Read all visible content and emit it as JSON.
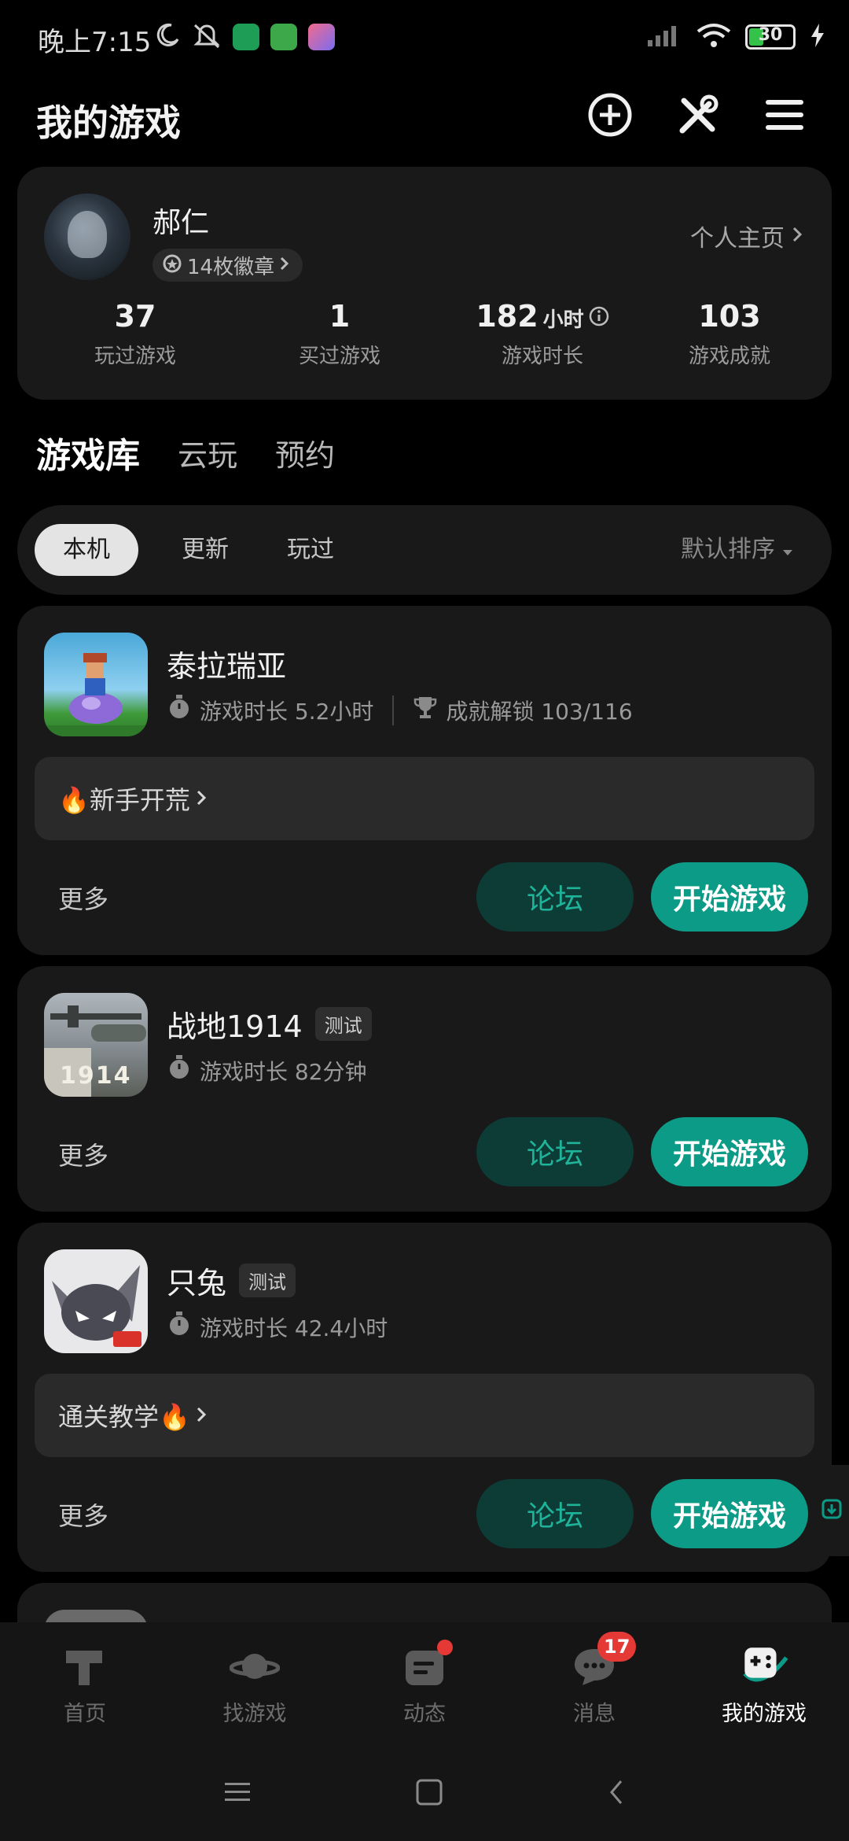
{
  "status_bar": {
    "time": "晚上7:15",
    "battery": "30"
  },
  "header": {
    "title": "我的游戏"
  },
  "profile": {
    "username": "郝仁",
    "badges": "14枚徽章",
    "profile_link": "个人主页",
    "stats": [
      {
        "value": "37",
        "unit": "",
        "label": "玩过游戏"
      },
      {
        "value": "1",
        "unit": "",
        "label": "买过游戏"
      },
      {
        "value": "182",
        "unit": "小时",
        "label": "游戏时长"
      },
      {
        "value": "103",
        "unit": "",
        "label": "游戏成就"
      }
    ]
  },
  "section_tabs": [
    "游戏库",
    "云玩",
    "预约"
  ],
  "filters": {
    "chips": [
      "本机",
      "更新",
      "玩过"
    ],
    "sort": "默认排序"
  },
  "games": [
    {
      "name": "泰拉瑞亚",
      "tag": "",
      "playtime": "游戏时长 5.2小时",
      "achievements": "成就解锁 103/116",
      "tip": "🔥新手开荒",
      "more": "更多",
      "forum": "论坛",
      "start": "开始游戏"
    },
    {
      "name": "战地1914",
      "tag": "测试",
      "playtime": "游戏时长 82分钟",
      "more": "更多",
      "forum": "论坛",
      "start": "开始游戏",
      "icon_text": "1914"
    },
    {
      "name": "只兔",
      "tag": "测试",
      "playtime": "游戏时长 42.4小时",
      "tip": "通关教学🔥",
      "more": "更多",
      "forum": "论坛",
      "start": "开始游戏"
    }
  ],
  "bottom_nav": [
    {
      "label": "首页",
      "icon": "home-hammer-icon"
    },
    {
      "label": "找游戏",
      "icon": "planet-icon"
    },
    {
      "label": "动态",
      "icon": "feed-icon"
    },
    {
      "label": "消息",
      "icon": "chat-icon",
      "badge": "17"
    },
    {
      "label": "我的游戏",
      "icon": "gamepad-icon"
    }
  ],
  "colors": {
    "accent": "#0c9b86",
    "forum_bg": "#0d3b35",
    "card_bg": "#191919",
    "badge_red": "#e53935"
  }
}
